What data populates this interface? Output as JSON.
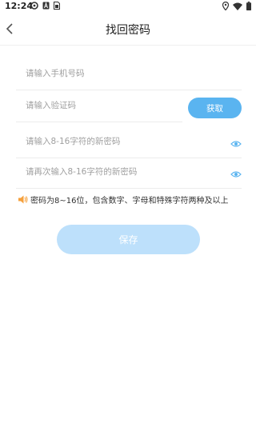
{
  "status_bar": {
    "time": "12:24",
    "left_icons": [
      "settings-icon",
      "a-badge-icon",
      "sim-icon"
    ],
    "right_icons": [
      "location-icon",
      "wifi-icon",
      "battery-icon"
    ]
  },
  "nav": {
    "title": "找回密码",
    "back_icon": "chevron-left-icon"
  },
  "form": {
    "phone_placeholder": "请输入手机号码",
    "phone_value": "",
    "code_placeholder": "请输入验证码",
    "code_value": "",
    "get_code_label": "获取",
    "password_placeholder": "请输入8-16字符的新密码",
    "password_value": "",
    "confirm_placeholder": "请再次输入8-16字符的新密码",
    "confirm_value": "",
    "hint": "密码为8~16位，包含数字、字母和特殊字符两种及以上",
    "save_label": "保存"
  },
  "colors": {
    "accent": "#5ab4f0",
    "save_disabled": "#bde0fb",
    "hint_icon": "#f5a03c",
    "placeholder": "#a0a0a0",
    "divider": "#ececec"
  }
}
